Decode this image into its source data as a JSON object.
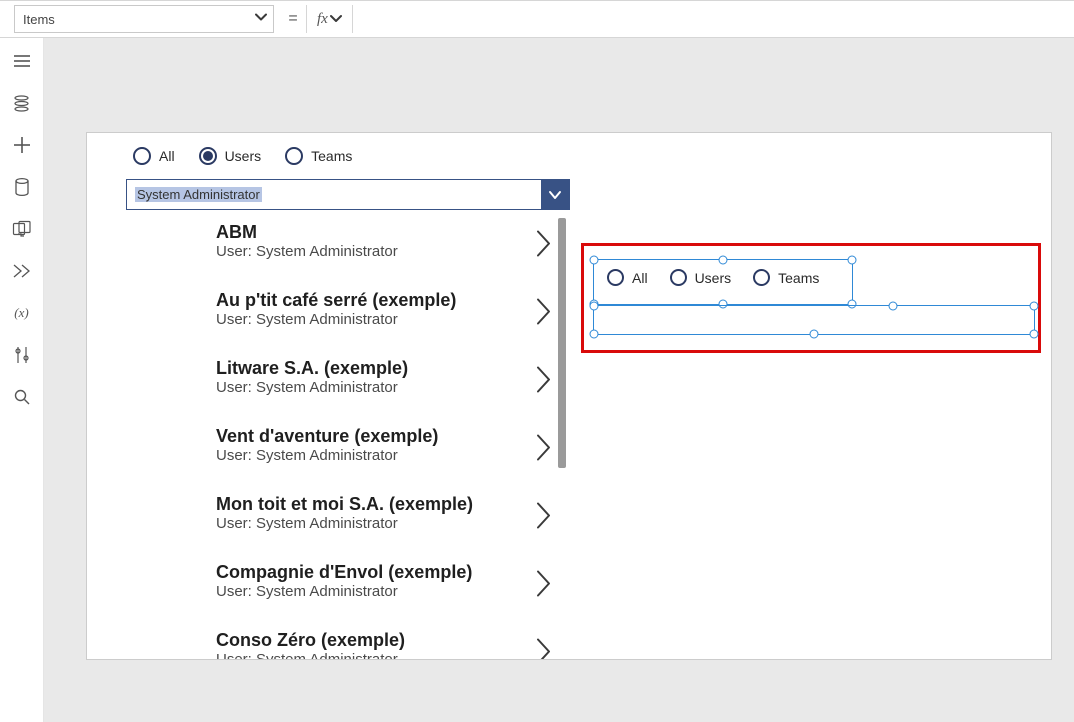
{
  "formula": {
    "property": "Items",
    "equals": "=",
    "fx_label": "fx",
    "value": ""
  },
  "rail": {
    "icons": {
      "hamburger": "hamburger-icon",
      "tree": "tree-icon",
      "plus": "plus-icon",
      "data": "database-icon",
      "media": "media-icon",
      "pen": "pen-icon",
      "var": "(x)",
      "tools": "tool-icon",
      "search": "search-icon"
    }
  },
  "canvas": {
    "filters": {
      "options": [
        {
          "label": "All",
          "selected": false
        },
        {
          "label": "Users",
          "selected": true
        },
        {
          "label": "Teams",
          "selected": false
        }
      ]
    },
    "dropdown_value": "System Administrator",
    "user_line_prefix": "User: ",
    "items": [
      {
        "title": "ABM",
        "user": "System Administrator"
      },
      {
        "title": "Au p'tit café serré (exemple)",
        "user": "System Administrator"
      },
      {
        "title": "Litware S.A. (exemple)",
        "user": "System Administrator"
      },
      {
        "title": "Vent d'aventure (exemple)",
        "user": "System Administrator"
      },
      {
        "title": "Mon toit et moi S.A. (exemple)",
        "user": "System Administrator"
      },
      {
        "title": "Compagnie d'Envol (exemple)",
        "user": "System Administrator"
      },
      {
        "title": "Conso Zéro (exemple)",
        "user": "System Administrator"
      }
    ],
    "right_filters": {
      "options": [
        {
          "label": "All"
        },
        {
          "label": "Users"
        },
        {
          "label": "Teams"
        }
      ]
    }
  },
  "colors": {
    "accent": "#385285",
    "selection": "#2f89d6",
    "highlight": "#d90a0a"
  }
}
